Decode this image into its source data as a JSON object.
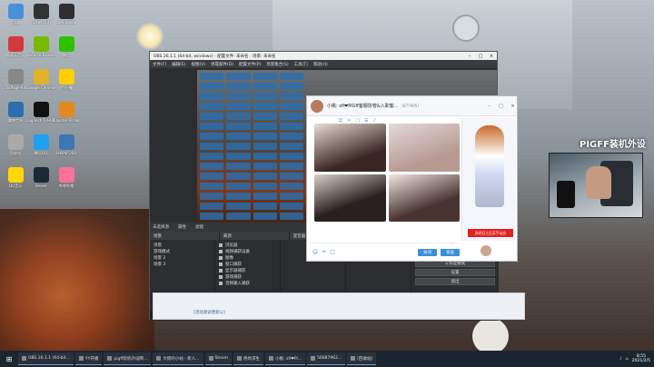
{
  "wallpaper": {
    "title": "PIGFF装机外设"
  },
  "desktop_icons": [
    {
      "label": "此电脑",
      "color": "#4a90d9"
    },
    {
      "label": "网易云音乐",
      "color": "#d23b3b"
    },
    {
      "label": "TotPage-64",
      "color": "#888"
    },
    {
      "label": "魔兽世界",
      "color": "#2a6fb0"
    },
    {
      "label": "回收站",
      "color": "#aaa"
    },
    {
      "label": "QQ音乐",
      "color": "#ffd800"
    },
    {
      "label": "Call of Duty",
      "color": "#333"
    },
    {
      "label": "GeForce Experience",
      "color": "#76b900"
    },
    {
      "label": "Google Chrome",
      "color": "#e0b12a"
    },
    {
      "label": "Logitech G HUB",
      "color": "#111"
    },
    {
      "label": "腾讯QQ",
      "color": "#1ea1f2"
    },
    {
      "label": "Steam",
      "color": "#1b2838"
    },
    {
      "label": "OBS Studio",
      "color": "#302e31"
    },
    {
      "label": "微信",
      "color": "#2dc100"
    },
    {
      "label": "YY开播",
      "color": "#ffcd00"
    },
    {
      "label": "Counter-Strike",
      "color": "#e28b1c"
    },
    {
      "label": "HWiNFO64",
      "color": "#3c78b5"
    },
    {
      "label": "哔哩哔哩",
      "color": "#fb7299"
    }
  ],
  "obs": {
    "title": "OBS 26.1.1 (64-bit, windows) - 配置文件: 未命名 - 场景: 未命名",
    "menu": [
      "文件(F)",
      "编辑(E)",
      "视图(V)",
      "停靠部件(D)",
      "配置文件(P)",
      "场景集合(S)",
      "工具(T)",
      "帮助(H)"
    ],
    "scene_bar": [
      "未选择源",
      "属性",
      "滤镜"
    ],
    "panel_heads": [
      "场景",
      "来源",
      "混音器",
      "转场特效",
      "控件"
    ],
    "scenes": [
      "场景",
      "游戏模式",
      "场景 2",
      "场景 3"
    ],
    "sources": [
      "浏览器",
      "视频捕获设备",
      "图像",
      "窗口捕获",
      "显示器捕获",
      "游戏捕获",
      "音频输入捕获"
    ],
    "controls": [
      "开始推流",
      "开始录制",
      "工作室模式",
      "设置",
      "退出"
    ],
    "status": {
      "live": "LIVE: 00:35:21",
      "rec": "REC: 00:00:00",
      "cpu": "CPU: 1.9%, 60.00 fps",
      "kbps": "kb/s: 1598"
    }
  },
  "chat": {
    "name": "小桃: sfi❤PiGff客服协管&入职客...",
    "id": "[877995]",
    "tools": [
      "☺",
      "✂",
      "▢",
      "☰",
      "♪"
    ],
    "banner": "和明日之后买手动态",
    "send_label": "发送",
    "close_label": "关闭"
  },
  "light_panel": {
    "toast": "[活动测试更新以]"
  },
  "taskbar": {
    "items": [
      {
        "label": "OBS 26.1.1 (64-bit...",
        "icon": "obs-icon"
      },
      {
        "label": "YY开播",
        "icon": "yy-icon"
      },
      {
        "label": "pigff装机外设网...",
        "icon": "chrome-icon"
      },
      {
        "label": "大佬的小站 - 新人...",
        "icon": "browser-icon"
      },
      {
        "label": "Steam",
        "icon": "steam-icon"
      },
      {
        "label": "绝地求生",
        "icon": "pubg-icon"
      },
      {
        "label": "小桃: sfi❤Pi...",
        "icon": "qq-icon"
      },
      {
        "label": "56887962...",
        "icon": "qq-icon"
      },
      {
        "label": "[回收站]",
        "icon": "folder-icon"
      }
    ],
    "time": "8:55",
    "date": "2021/2/5"
  }
}
